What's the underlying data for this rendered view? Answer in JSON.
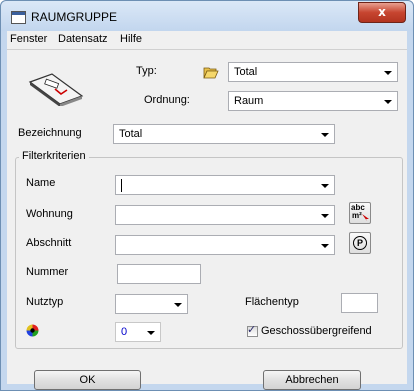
{
  "window": {
    "title": "RAUMGRUPPE",
    "close_glyph": "x"
  },
  "menu": [
    "Fenster",
    "Datensatz",
    "Hilfe"
  ],
  "header": {
    "typ_label": "Typ:",
    "typ_value": "Total",
    "ordnung_label": "Ordnung:",
    "ordnung_value": "Raum"
  },
  "bezeichnung": {
    "label": "Bezeichnung",
    "value": "Total"
  },
  "filter": {
    "title": "Filterkriterien",
    "name_label": "Name",
    "name_value": "",
    "wohnung_label": "Wohnung",
    "wohnung_value": "",
    "abschnitt_label": "Abschnitt",
    "abschnitt_value": "",
    "nummer_label": "Nummer",
    "nummer_value": "",
    "nutztyp_label": "Nutztyp",
    "nutztyp_value": "",
    "flaechentyp_label": "Flächentyp",
    "flaechentyp_value": "",
    "color_value": "0",
    "geschoss_label": "Geschossübergreifend",
    "geschoss_checked": true,
    "abc_icon_text": "abc",
    "m2_icon_text": "m²",
    "p_icon_text": "P"
  },
  "buttons": {
    "ok": "OK",
    "cancel": "Abbrechen"
  },
  "colors": {
    "title_bg": "#c4d7ee",
    "close": "#c74530",
    "client_bg": "#f0f0f0",
    "value_blue": "#0000cc"
  }
}
